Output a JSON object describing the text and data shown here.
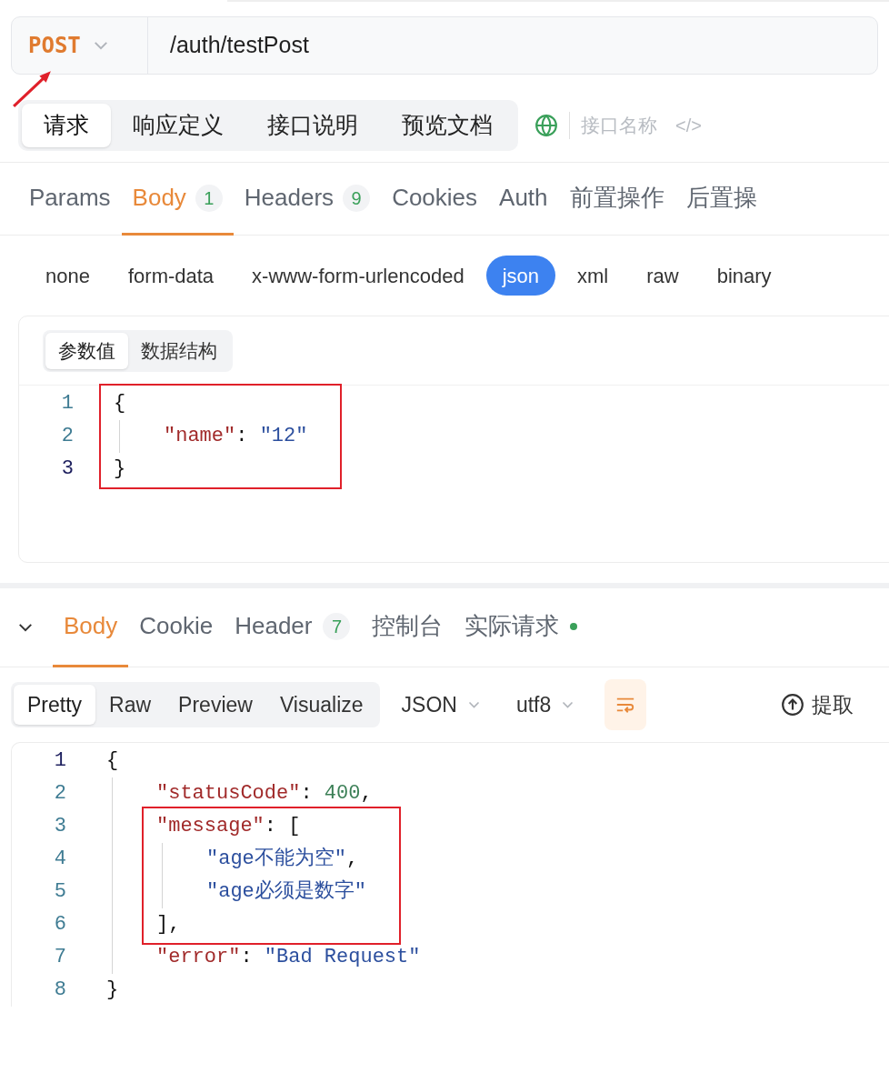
{
  "request_bar": {
    "method": "POST",
    "path": "/auth/testPost"
  },
  "view_tabs": [
    {
      "label": "请求",
      "selected": true
    },
    {
      "label": "响应定义",
      "selected": false
    },
    {
      "label": "接口说明",
      "selected": false
    },
    {
      "label": "预览文档",
      "selected": false
    }
  ],
  "name_field": {
    "placeholder": "接口名称"
  },
  "code_toggle": "</>",
  "request_tabs": [
    {
      "label": "Params",
      "selected": false
    },
    {
      "label": "Body",
      "count": "1",
      "selected": true
    },
    {
      "label": "Headers",
      "count": "9",
      "selected": false
    },
    {
      "label": "Cookies",
      "selected": false
    },
    {
      "label": "Auth",
      "selected": false
    },
    {
      "label": "前置操作",
      "selected": false
    },
    {
      "label": "后置操",
      "selected": false
    }
  ],
  "body_types": [
    {
      "label": "none",
      "selected": false
    },
    {
      "label": "form-data",
      "selected": false
    },
    {
      "label": "x-www-form-urlencoded",
      "selected": false
    },
    {
      "label": "json",
      "selected": true
    },
    {
      "label": "xml",
      "selected": false
    },
    {
      "label": "raw",
      "selected": false
    },
    {
      "label": "binary",
      "selected": false
    }
  ],
  "editor_tabs": [
    {
      "label": "参数值",
      "selected": true
    },
    {
      "label": "数据结构",
      "selected": false
    }
  ],
  "request_code": [
    {
      "kind": "group",
      "highlighted": true,
      "children": [
        {
          "kind": "line",
          "number": "1",
          "active": false,
          "tokens": [
            {
              "kind": "punct",
              "text": "{"
            }
          ],
          "children": [
            {
              "kind": "line",
              "number": "2",
              "active": false,
              "tokens": [
                {
                  "kind": "key",
                  "text": "\"name\""
                },
                {
                  "kind": "punct",
                  "text": ": "
                },
                {
                  "kind": "string",
                  "text": "\"12\""
                }
              ]
            }
          ]
        },
        {
          "kind": "line",
          "number": "3",
          "active": true,
          "tokens": [
            {
              "kind": "punct",
              "text": "}"
            }
          ]
        }
      ]
    }
  ],
  "response_tabs": [
    {
      "label": "Body",
      "selected": true
    },
    {
      "label": "Cookie",
      "selected": false
    },
    {
      "label": "Header",
      "count": "7",
      "selected": false
    },
    {
      "label": "控制台",
      "selected": false
    },
    {
      "label": "实际请求",
      "dot": true,
      "selected": false
    }
  ],
  "format_tabs": [
    {
      "label": "Pretty",
      "selected": true
    },
    {
      "label": "Raw",
      "selected": false
    },
    {
      "label": "Preview",
      "selected": false
    },
    {
      "label": "Visualize",
      "selected": false
    }
  ],
  "format_selects": [
    "JSON",
    "utf8"
  ],
  "wrap_on": true,
  "extract_label": "提取",
  "response_code": [
    {
      "kind": "line",
      "number": "1",
      "active": true,
      "tokens": [
        {
          "kind": "punct",
          "text": "{"
        }
      ],
      "children": [
        {
          "kind": "line",
          "number": "2",
          "active": false,
          "tokens": [
            {
              "kind": "key",
              "text": "\"statusCode\""
            },
            {
              "kind": "punct",
              "text": ": "
            },
            {
              "kind": "number",
              "text": "400"
            },
            {
              "kind": "punct",
              "text": ","
            }
          ]
        },
        {
          "kind": "group",
          "highlighted": true,
          "children": [
            {
              "kind": "line",
              "number": "3",
              "active": false,
              "tokens": [
                {
                  "kind": "key",
                  "text": "\"message\""
                },
                {
                  "kind": "punct",
                  "text": ": ["
                }
              ],
              "children": [
                {
                  "kind": "line",
                  "number": "4",
                  "active": false,
                  "tokens": [
                    {
                      "kind": "string",
                      "text": "\"age不能为空\""
                    },
                    {
                      "kind": "punct",
                      "text": ","
                    }
                  ]
                },
                {
                  "kind": "line",
                  "number": "5",
                  "active": false,
                  "tokens": [
                    {
                      "kind": "string",
                      "text": "\"age必须是数字\""
                    }
                  ]
                }
              ]
            },
            {
              "kind": "line",
              "number": "6",
              "active": false,
              "tokens": [
                {
                  "kind": "punct",
                  "text": "],"
                }
              ]
            }
          ]
        },
        {
          "kind": "line",
          "number": "7",
          "active": false,
          "tokens": [
            {
              "kind": "key",
              "text": "\"error\""
            },
            {
              "kind": "punct",
              "text": ": "
            },
            {
              "kind": "string",
              "text": "\"Bad Request\""
            }
          ]
        }
      ]
    },
    {
      "kind": "line",
      "number": "8",
      "active": false,
      "tokens": [
        {
          "kind": "punct",
          "text": "}"
        }
      ]
    }
  ]
}
